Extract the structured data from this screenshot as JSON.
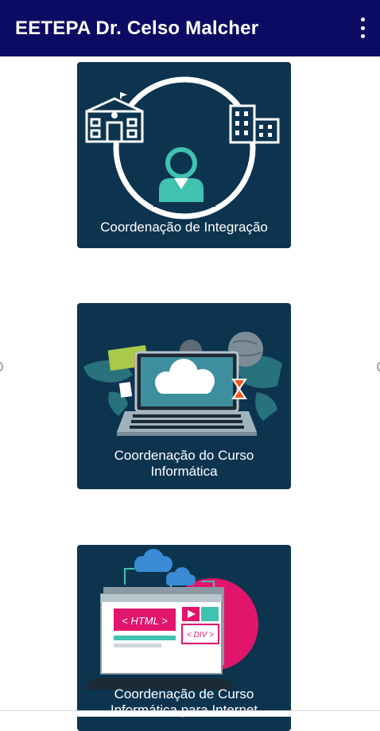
{
  "app_bar": {
    "title": "EETEPA Dr. Celso Malcher",
    "menu_icon": "more-vert-icon"
  },
  "cards": [
    {
      "label": "Coordenação de Integração",
      "illustration": "school-person-building-icon"
    },
    {
      "label_line1": "Coordenação do Curso",
      "label_line2": "Informática",
      "illustration": "laptop-cloud-world-icon"
    },
    {
      "label_line1": "Coordenação de Curso",
      "label_line2": "Informática para Internet",
      "illustration": "web-html-cloud-icon",
      "html_tag": "< HTML >",
      "div_tag": "< DIV >"
    }
  ],
  "colors": {
    "app_bar": "#0c0b63",
    "card_bg": "#0d344f",
    "accent_teal": "#40c2b0",
    "accent_pink": "#e1156c"
  }
}
